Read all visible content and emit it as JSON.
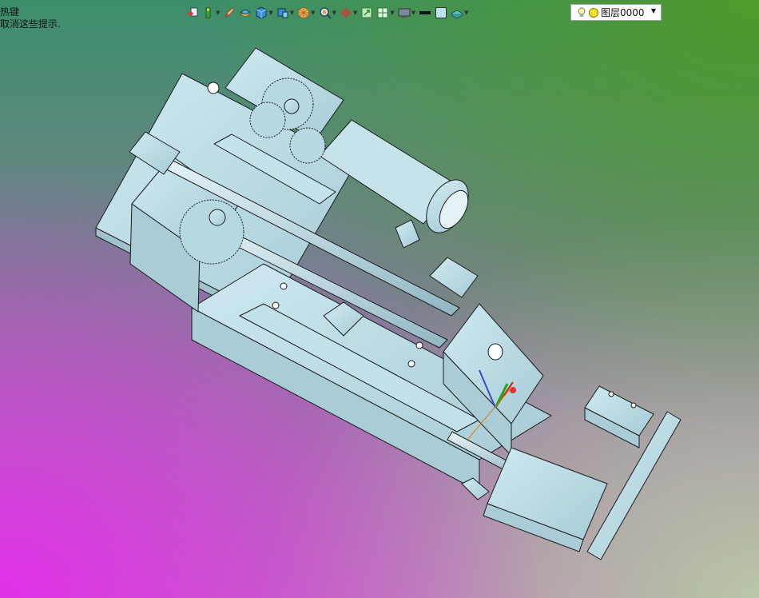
{
  "viewport": {
    "hint_lines": [
      "热键",
      "取消这些提示."
    ]
  },
  "toolbar": {
    "buttons": [
      {
        "name": "import-icon",
        "has_dropdown": false
      },
      {
        "name": "measure-icon",
        "has_dropdown": true
      },
      {
        "name": "pen-icon",
        "has_dropdown": false
      },
      {
        "name": "stack-icon",
        "has_dropdown": false
      },
      {
        "name": "cube-icon",
        "has_dropdown": true
      },
      {
        "name": "view-cube-icon",
        "has_dropdown": true
      },
      {
        "name": "render-sphere-icon",
        "has_dropdown": true
      },
      {
        "name": "zoom-icon",
        "has_dropdown": true
      },
      {
        "name": "pivot-icon",
        "has_dropdown": true
      },
      {
        "name": "fit-icon",
        "has_dropdown": false
      },
      {
        "name": "section-icon",
        "has_dropdown": true
      },
      {
        "name": "display-icon",
        "has_dropdown": true
      },
      {
        "name": "line-color-icon",
        "has_dropdown": false
      },
      {
        "name": "fill-color-icon",
        "has_dropdown": false
      },
      {
        "name": "material-icon",
        "has_dropdown": true
      }
    ],
    "layer": {
      "label": "图层0000"
    }
  },
  "colors": {
    "part_fill": "#b9dbe4",
    "part_edge": "#1a1a1a",
    "bg_top_right": "#4e9a2a",
    "bg_bottom_left": "#e030e8"
  }
}
